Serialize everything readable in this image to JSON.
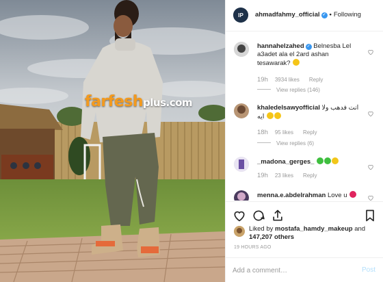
{
  "watermark": {
    "part1": "farfesh",
    "part2": "plus.com"
  },
  "post": {
    "author": "ahmadfahmy_official",
    "separator": "•",
    "follow_status": "Following"
  },
  "comments": [
    {
      "user": "hannahelzahed",
      "verified": true,
      "text": "Belnesba Lel a3adet ala el 2ard ashan tesawarak?",
      "emoji": "grinning-sweat-emoji",
      "age": "19h",
      "likes": "3934 likes",
      "reply": "Reply",
      "replies": "View replies (146)"
    },
    {
      "user": "khaledelsawyofficial",
      "text": "انت فدهب ولا ايه",
      "emoji": "rofl-emoji x2",
      "age": "18h",
      "likes": "95 likes",
      "reply": "Reply",
      "replies": "View replies (6)"
    },
    {
      "user": "_madona_gerges_",
      "text": "",
      "emoji": "green-heart green-heart yellow-heart",
      "age": "19h",
      "likes": "23 likes",
      "reply": "Reply"
    },
    {
      "user": "menna.e.abdelrahman",
      "text": "Love u",
      "emoji": "red-heart"
    }
  ],
  "likes": {
    "prefix": "Liked by",
    "user": "mostafa_hamdy_makeup",
    "conj": "and",
    "count": "147,207 others"
  },
  "timestamp": "19 HOURS AGO",
  "composer": {
    "placeholder": "Add a comment…",
    "post_label": "Post"
  },
  "colors": {
    "accent": "#3897f0",
    "post_disabled": "#b2dffc",
    "watermark_orange": "#f39a1e"
  }
}
